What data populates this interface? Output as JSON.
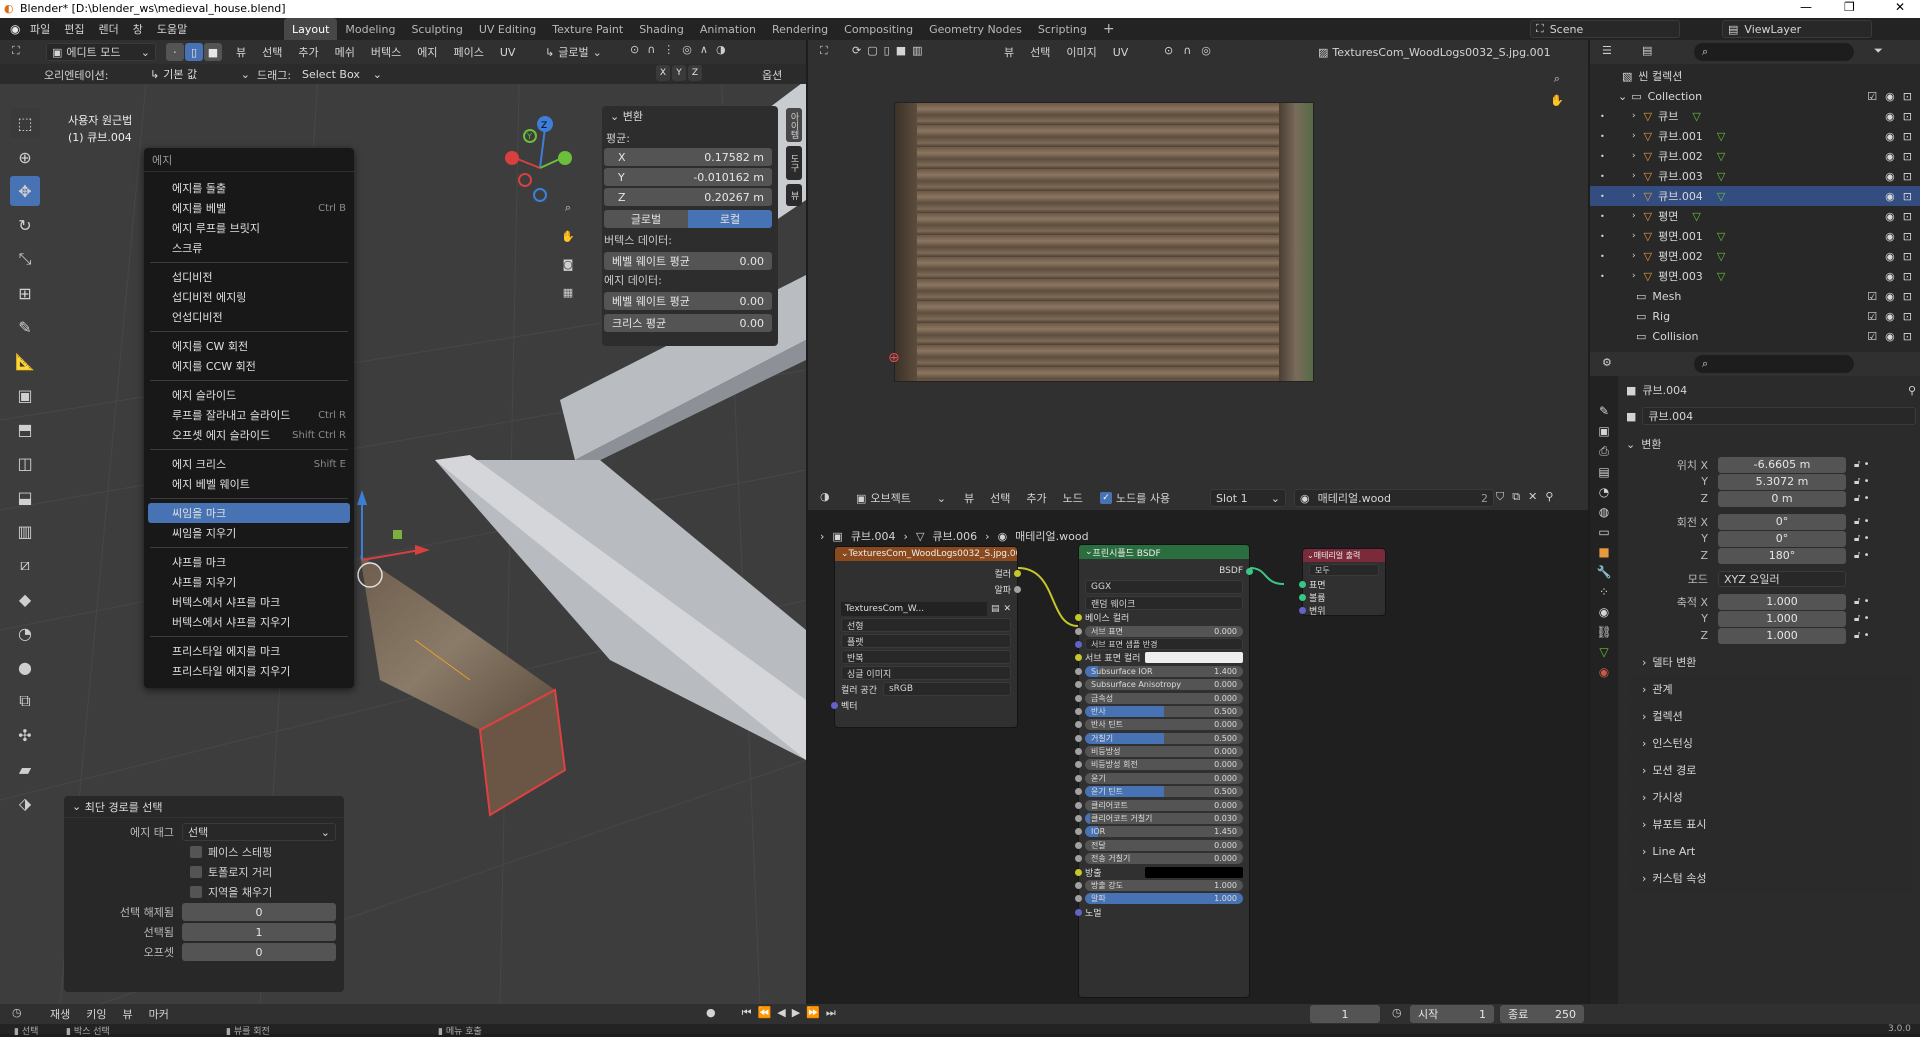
{
  "title": "Blender* [D:\\blender_ws\\medieval_house.blend]",
  "menus": [
    "파일",
    "편집",
    "렌더",
    "창",
    "도움말"
  ],
  "workspaces": [
    "Layout",
    "Modeling",
    "Sculpting",
    "UV Editing",
    "Texture Paint",
    "Shading",
    "Animation",
    "Rendering",
    "Compositing",
    "Geometry Nodes",
    "Scripting"
  ],
  "active_workspace": "Layout",
  "scene": "Scene",
  "view_layer": "ViewLayer",
  "viewport": {
    "mode": "에디트 모드",
    "menu": [
      "뷰",
      "선택",
      "추가",
      "메쉬",
      "버텍스",
      "에지",
      "페이스",
      "UV"
    ],
    "transform_orient": "글로벌",
    "options": "옵션",
    "orient_label": "오리엔테이션:",
    "orient_value": "기본 값",
    "drag_label": "드래그:",
    "drag_value": "Select Box",
    "view_name": "사용자 원근법",
    "object_name": "(1) 큐브.004",
    "n_panel": {
      "header": "변환",
      "median": "평균:",
      "x": "0.17582 m",
      "y": "-0.010162 m",
      "z": "0.20267 m",
      "global": "글로벌",
      "local": "로컬",
      "vertex_data": "버텍스 데이터:",
      "vert_bevel": "베벨 웨이트 평균",
      "vert_bevel_v": "0.00",
      "edge_data": "에지 데이터:",
      "edge_bevel": "베벨 웨이트 평균",
      "edge_bevel_v": "0.00",
      "crease": "크리스 평균",
      "crease_v": "0.00"
    },
    "side_tabs": [
      "아이템",
      "도구",
      "뷰"
    ]
  },
  "edge_menu": {
    "title": "에지",
    "items": [
      {
        "label": "에지를 돌출",
        "sc": ""
      },
      {
        "label": "에지를 베벨",
        "sc": "Ctrl B"
      },
      {
        "label": "에지 루프를 브릿지",
        "sc": ""
      },
      {
        "label": "스크류",
        "sc": ""
      },
      {
        "sep": true
      },
      {
        "label": "섭디비전",
        "sc": ""
      },
      {
        "label": "섭디비전 에지링",
        "sc": ""
      },
      {
        "label": "언섭디비전",
        "sc": ""
      },
      {
        "sep": true
      },
      {
        "label": "에지를 CW 회전",
        "sc": ""
      },
      {
        "label": "에지를 CCW 회전",
        "sc": ""
      },
      {
        "sep": true
      },
      {
        "label": "에지 슬라이드",
        "sc": ""
      },
      {
        "label": "루프를 잘라내고 슬라이드",
        "sc": "Ctrl R"
      },
      {
        "label": "오프셋 에지 슬라이드",
        "sc": "Shift Ctrl R"
      },
      {
        "sep": true
      },
      {
        "label": "에지 크리스",
        "sc": "Shift E"
      },
      {
        "label": "에지 베벨 웨이트",
        "sc": ""
      },
      {
        "sep": true
      },
      {
        "label": "씨임을 마크",
        "sc": "",
        "active": true
      },
      {
        "label": "씨임을 지우기",
        "sc": ""
      },
      {
        "sep": true
      },
      {
        "label": "샤프를 마크",
        "sc": ""
      },
      {
        "label": "샤프를 지우기",
        "sc": ""
      },
      {
        "label": "버텍스에서 샤프를 마크",
        "sc": ""
      },
      {
        "label": "버텍스에서 샤프를 지우기",
        "sc": ""
      },
      {
        "sep": true
      },
      {
        "label": "프리스타일 에지를 마크",
        "sc": ""
      },
      {
        "label": "프리스타일 에지를 지우기",
        "sc": ""
      }
    ]
  },
  "op_panel": {
    "title": "최단 경로를 선택",
    "edge_tag": "에지 태그",
    "edge_tag_v": "선택",
    "face_step": "페이스 스테핑",
    "topo": "토폴로지 거리",
    "fill": "지역을 채우기",
    "deselect": "선택 해제됨",
    "deselect_v": "0",
    "selected": "선택됨",
    "selected_v": "1",
    "offset": "오프셋",
    "offset_v": "0"
  },
  "image_editor": {
    "menu": [
      "뷰",
      "선택",
      "이미지",
      "UV"
    ],
    "image": "TexturesCom_WoodLogs0032_S.jpg.001"
  },
  "node_editor": {
    "type": "오브젝트",
    "menu": [
      "뷰",
      "선택",
      "추가",
      "노드"
    ],
    "use_nodes": "노드를 사용",
    "slot": "Slot 1",
    "material": "매테리얼.wood",
    "users": "2",
    "breadcrumb": [
      "큐브.004",
      "큐브.006",
      "매테리얼.wood"
    ],
    "tex_node": {
      "title": "TexturesCom_WoodLogs0032_S.jpg.00",
      "out_color": "컬러",
      "out_alpha": "알파",
      "img": "TexturesCom_W...",
      "interp": "선형",
      "proj": "플랫",
      "ext": "반복",
      "src": "싱글 이미지",
      "cs_label": "컬러 공간",
      "cs": "sRGB",
      "vec": "벡터"
    },
    "bsdf": {
      "title": "프린시플드 BSDF",
      "out": "BSDF",
      "dist": "GGX",
      "sss_method": "랜덤 웨이크",
      "rows": [
        {
          "l": "베이스 컬러",
          "t": "socket"
        },
        {
          "l": "서브 표면",
          "v": "0.000",
          "f": 0
        },
        {
          "l": "서브 표면 샘플 반경",
          "t": "dd"
        },
        {
          "l": "서브 표면 컬러",
          "t": "color"
        },
        {
          "l": "Subsurface IOR",
          "v": "1.400",
          "f": 0.08
        },
        {
          "l": "Subsurface Anisotropy",
          "v": "0.000",
          "f": 0
        },
        {
          "l": "금속성",
          "v": "0.000",
          "f": 0
        },
        {
          "l": "반사",
          "v": "0.500",
          "f": 0.5
        },
        {
          "l": "반사 틴트",
          "v": "0.000",
          "f": 0
        },
        {
          "l": "거칠기",
          "v": "0.500",
          "f": 0.5
        },
        {
          "l": "비등방성",
          "v": "0.000",
          "f": 0
        },
        {
          "l": "비등방성 회전",
          "v": "0.000",
          "f": 0
        },
        {
          "l": "윤기",
          "v": "0.000",
          "f": 0
        },
        {
          "l": "윤기 틴트",
          "v": "0.500",
          "f": 0.5
        },
        {
          "l": "클리어코트",
          "v": "0.000",
          "f": 0
        },
        {
          "l": "클리어코트 거칠기",
          "v": "0.030",
          "f": 0.03
        },
        {
          "l": "IOR",
          "v": "1.450",
          "f": 0.08
        },
        {
          "l": "전달",
          "v": "0.000",
          "f": 0
        },
        {
          "l": "전송 거칠기",
          "v": "0.000",
          "f": 0
        },
        {
          "l": "방출",
          "t": "black"
        },
        {
          "l": "방출 강도",
          "v": "1.000",
          "f": 0
        },
        {
          "l": "알파",
          "v": "1.000",
          "f": 1
        },
        {
          "l": "노멀",
          "t": "socket"
        }
      ]
    },
    "output": {
      "title": "매테리얼 출력",
      "target": "모두",
      "surface": "표면",
      "volume": "볼륨",
      "disp": "변위"
    }
  },
  "outliner": {
    "title": "씬 컬렉션",
    "collection": "Collection",
    "items": [
      "큐브",
      "큐브.001",
      "큐브.002",
      "큐브.003",
      "큐브.004",
      "평면",
      "평면.001",
      "평면.002",
      "평면.003"
    ],
    "active": "큐브.004",
    "others": [
      "Mesh",
      "Rig",
      "Collision"
    ]
  },
  "props": {
    "obj": "큐브.004",
    "obj2": "큐브.004",
    "transform": "변환",
    "loc": "위치 X",
    "loc_x": "-6.6605 m",
    "loc_y": "5.3072 m",
    "loc_z": "0 m",
    "rot": "회전 X",
    "rot_x": "0°",
    "rot_y": "0°",
    "rot_z": "180°",
    "mode": "모드",
    "mode_v": "XYZ 오일러",
    "scale": "축적 X",
    "sc_x": "1.000",
    "sc_y": "1.000",
    "sc_z": "1.000",
    "y": "Y",
    "z": "Z",
    "delta": "델타 변환",
    "sections": [
      "관계",
      "컬렉션",
      "인스턴싱",
      "모션 경로",
      "가시성",
      "뷰포트 표시",
      "Line Art",
      "커스텀 속성"
    ]
  },
  "timeline": {
    "play": "재생",
    "key": "키잉",
    "view": "뷰",
    "marker": "마커",
    "frame": "1",
    "start_label": "시작",
    "start": "1",
    "end_label": "종료",
    "end": "250"
  },
  "status": {
    "select": "선택",
    "box": "박스 선택",
    "rotate": "뷰를 회전",
    "menu": "메뉴 호출",
    "version": "3.0.0"
  }
}
